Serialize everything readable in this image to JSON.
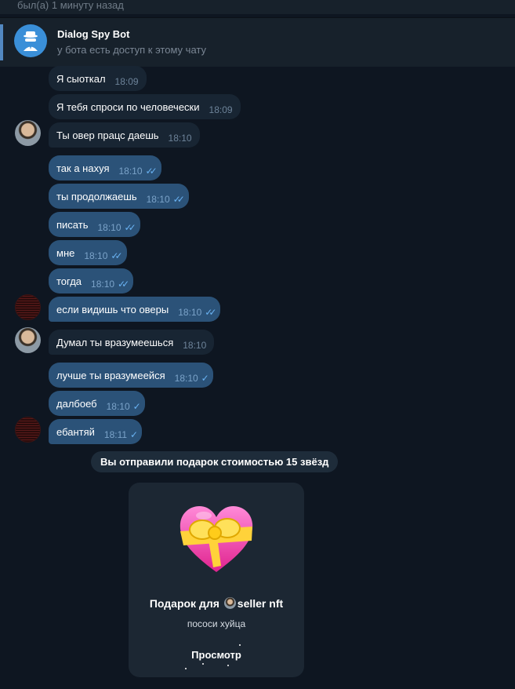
{
  "header": {
    "status": "был(а) 1 минуту назад"
  },
  "bot_banner": {
    "title": "Dialog Spy Bot",
    "subtitle": "у бота есть доступ к этому чату",
    "icon": "spy-icon"
  },
  "messages": [
    {
      "text": "Я сыоткал",
      "time": "18:09",
      "dir": "in"
    },
    {
      "text": "Я тебя спроси по человечески",
      "time": "18:09",
      "dir": "in"
    },
    {
      "text": "Ты овер працс даешь",
      "time": "18:10",
      "dir": "in"
    },
    {
      "text": "так а нахуя",
      "time": "18:10",
      "dir": "out",
      "ticks": "✓✓"
    },
    {
      "text": "ты продолжаешь",
      "time": "18:10",
      "dir": "out",
      "ticks": "✓✓"
    },
    {
      "text": "писать",
      "time": "18:10",
      "dir": "out",
      "ticks": "✓✓"
    },
    {
      "text": "мне",
      "time": "18:10",
      "dir": "out",
      "ticks": "✓✓"
    },
    {
      "text": "тогда",
      "time": "18:10",
      "dir": "out",
      "ticks": "✓✓"
    },
    {
      "text": "если видишь что оверы",
      "time": "18:10",
      "dir": "out",
      "ticks": "✓✓"
    },
    {
      "text": "Думал ты вразумеешься",
      "time": "18:10",
      "dir": "in"
    },
    {
      "text": "лучше ты вразумеейся",
      "time": "18:10",
      "dir": "out",
      "ticks": "✓"
    },
    {
      "text": "далбоеб",
      "time": "18:10",
      "dir": "out",
      "ticks": "✓"
    },
    {
      "text": "ебантяй",
      "time": "18:11",
      "dir": "out",
      "ticks": "✓"
    }
  ],
  "service_message": "Вы отправили подарок стоимостью 15 звёзд",
  "gift": {
    "title_prefix": "Подарок для",
    "recipient": "seller nft",
    "message": "пососи хуйца",
    "button": "Просмотр"
  }
}
